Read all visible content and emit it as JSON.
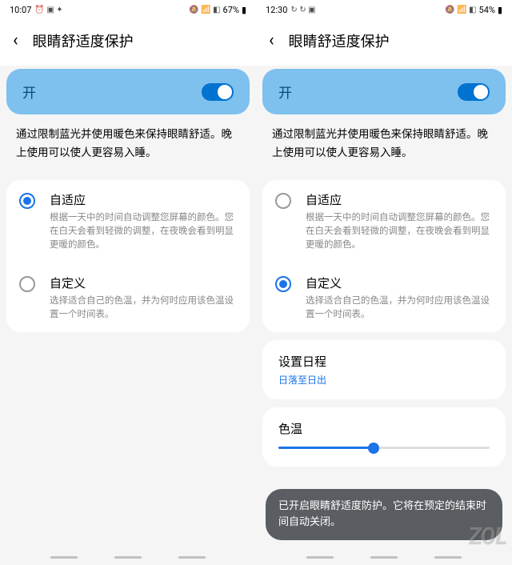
{
  "left": {
    "status": {
      "time": "10:07",
      "battery": "67%"
    },
    "title": "眼睛舒适度保护",
    "toggle_label": "开",
    "description": "通过限制蓝光并使用暖色来保持眼睛舒适。晚上使用可以使人更容易入睡。",
    "options": [
      {
        "title": "自适应",
        "desc": "根据一天中的时间自动调整您屏幕的颜色。您在白天会看到轻微的调整，在夜晚会看到明显更暖的颜色。",
        "selected": true
      },
      {
        "title": "自定义",
        "desc": "选择适合自己的色温，并为何时应用该色温设置一个时间表。",
        "selected": false
      }
    ]
  },
  "right": {
    "status": {
      "time": "12:30",
      "battery": "54%"
    },
    "title": "眼睛舒适度保护",
    "toggle_label": "开",
    "description": "通过限制蓝光并使用暖色来保持眼睛舒适。晚上使用可以使人更容易入睡。",
    "options": [
      {
        "title": "自适应",
        "desc": "根据一天中的时间自动调整您屏幕的颜色。您在白天会看到轻微的调整，在夜晚会看到明显更暖的颜色。",
        "selected": false
      },
      {
        "title": "自定义",
        "desc": "选择适合自己的色温，并为何时应用该色温设置一个时间表。",
        "selected": true
      }
    ],
    "schedule": {
      "title": "设置日程",
      "sub": "日落至日出"
    },
    "temp": {
      "title": "色温",
      "value_pct": 45
    },
    "toast": "已开启眼睛舒适度防护。它将在预定的结束时间自动关闭。"
  },
  "watermark": "ZOL"
}
